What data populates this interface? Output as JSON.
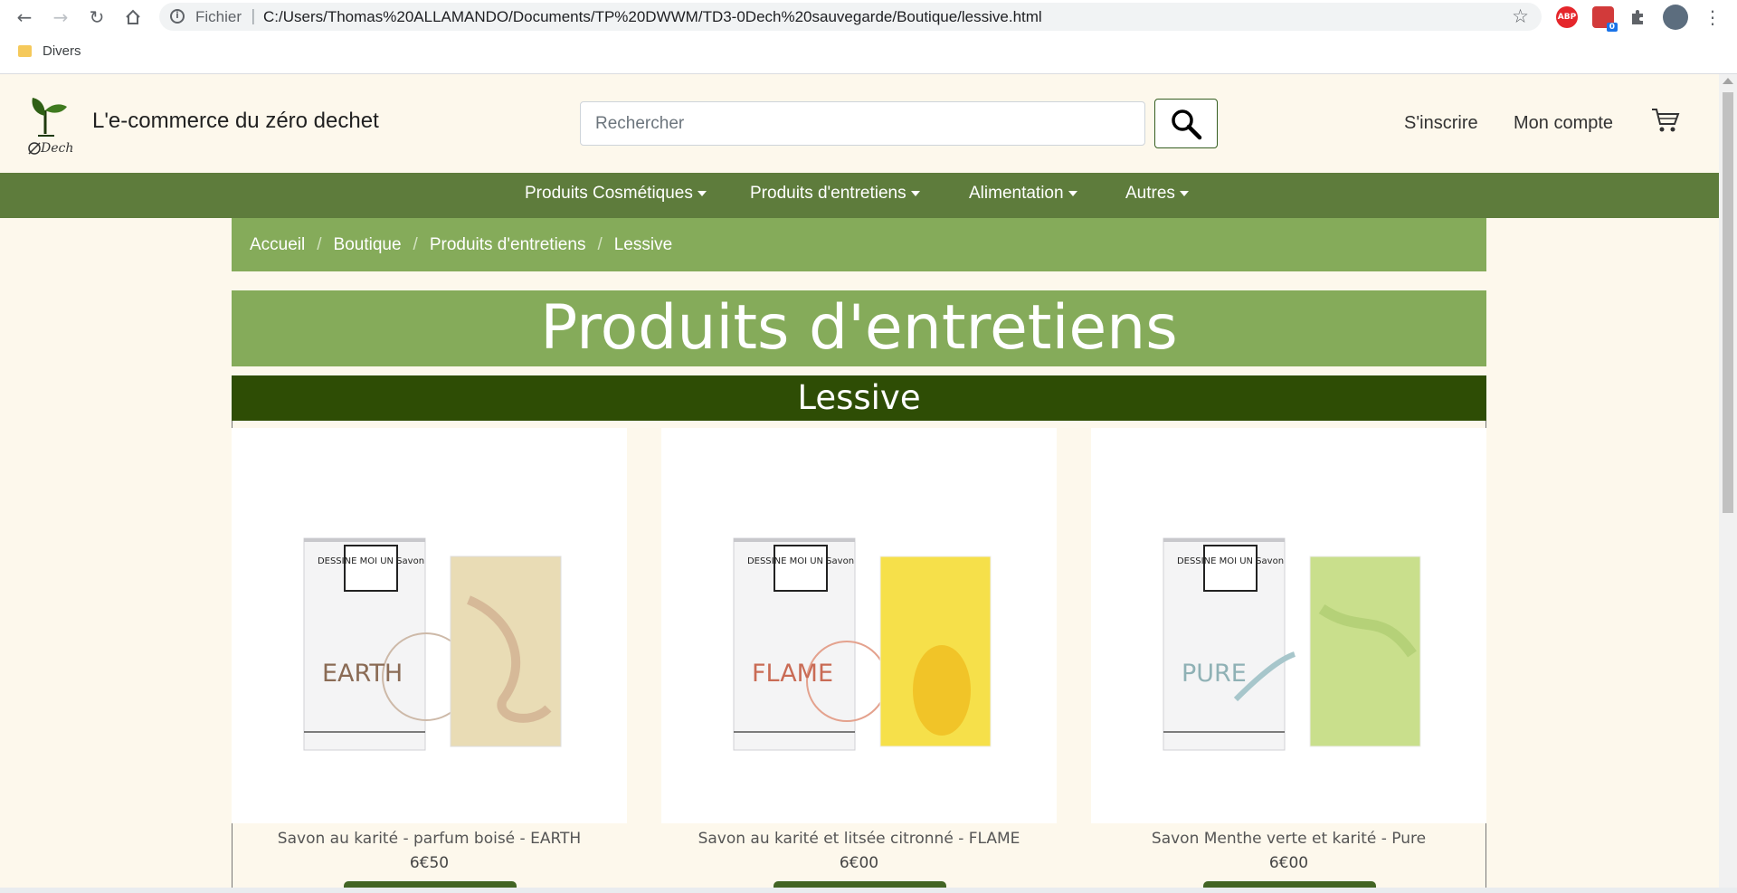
{
  "browser": {
    "scheme": "Fichier",
    "url": "C:/Users/Thomas%20ALLAMANDO/Documents/TP%20DWWM/TD3-0Dech%20sauvegarde/Boutique/lessive.html",
    "bookmark_folder": "Divers",
    "abp_label": "ABP",
    "badge_count": "0"
  },
  "site": {
    "logo_text": "Dech",
    "title": "L'e-commerce du zéro dechet",
    "search_placeholder": "Rechercher",
    "signup": "S'inscrire",
    "account": "Mon compte"
  },
  "nav": {
    "items": [
      "Produits Cosmétiques",
      "Produits d'entretiens",
      "Alimentation",
      "Autres"
    ]
  },
  "breadcrumb": [
    "Accueil",
    "Boutique",
    "Produits d'entretiens",
    "Lessive"
  ],
  "page_heading": "Produits d'entretiens",
  "section_heading": "Lessive",
  "products": [
    {
      "name": "Savon au karité - parfum boisé - EARTH",
      "price": "6€50",
      "box_label": "EARTH",
      "brand": "DESSINE MOI UN Savon",
      "soap_color": "#e9dcb5",
      "accent": "#b7896c"
    },
    {
      "name": "Savon au karité et litsée citronné - FLAME",
      "price": "6€00",
      "box_label": "FLAME",
      "brand": "DESSINE MOI UN Savon",
      "soap_color": "#f6e04a",
      "accent": "#c96b55"
    },
    {
      "name": "Savon Menthe verte et karité - Pure",
      "price": "6€00",
      "box_label": "PURE",
      "brand": "DESSINE MOI UN Savon",
      "soap_color": "#c9df8c",
      "accent": "#8fb1b5"
    }
  ],
  "colors": {
    "page_bg": "#fdf8ec",
    "nav_bg": "#5e7c3c",
    "light_green": "#85ab5a",
    "dark_green": "#2e4d05",
    "button_green": "#426524"
  }
}
